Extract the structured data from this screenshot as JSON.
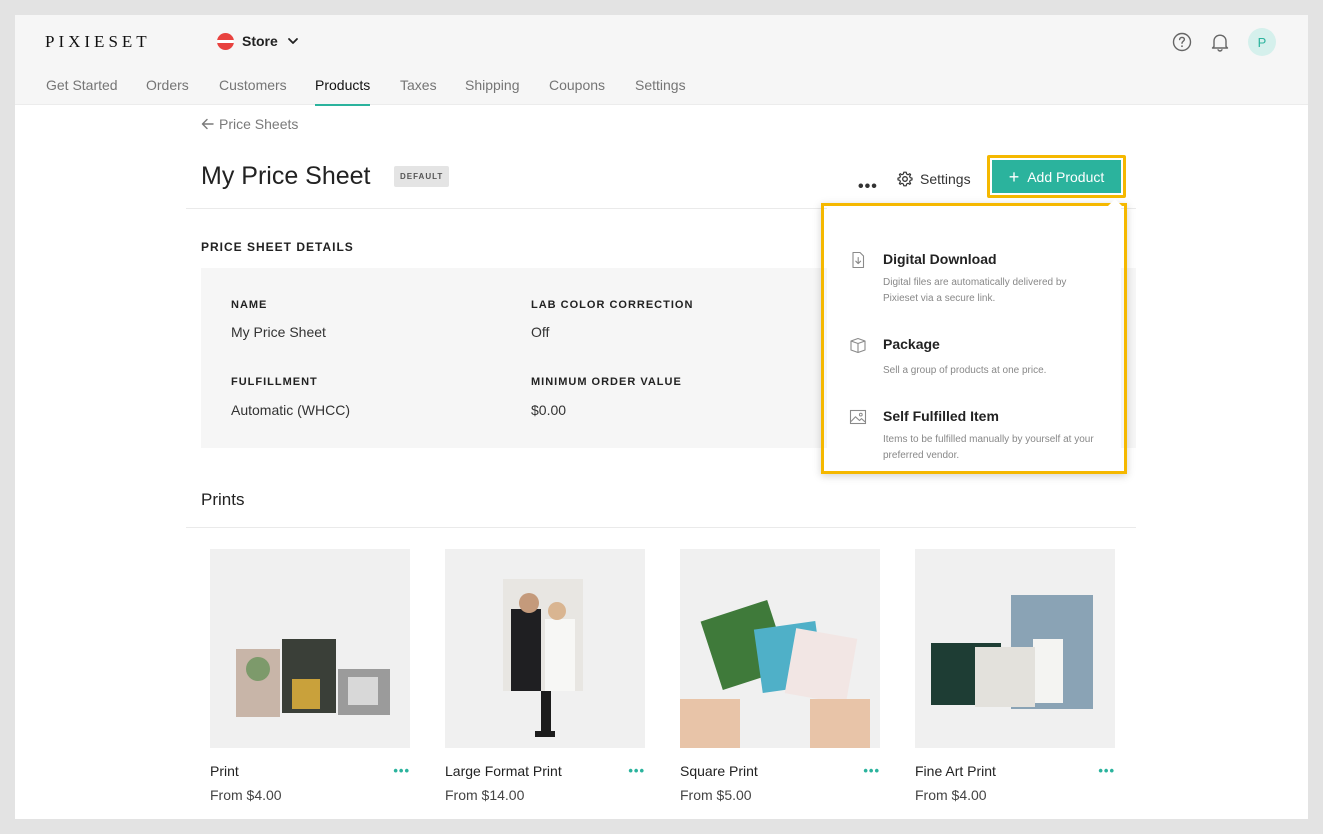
{
  "app": {
    "logo": "PIXIESET"
  },
  "store": {
    "label": "Store"
  },
  "top_icons": {
    "help": "help-icon",
    "notifications": "bell-icon"
  },
  "avatar": {
    "initial": "P"
  },
  "nav": {
    "items": [
      {
        "label": "Get Started"
      },
      {
        "label": "Orders"
      },
      {
        "label": "Customers"
      },
      {
        "label": "Products",
        "active": true
      },
      {
        "label": "Taxes"
      },
      {
        "label": "Shipping"
      },
      {
        "label": "Coupons"
      },
      {
        "label": "Settings"
      }
    ]
  },
  "breadcrumb": {
    "back_label": "Price Sheets"
  },
  "header": {
    "title": "My Price Sheet",
    "badge": "DEFAULT",
    "more": "•••",
    "settings_label": "Settings",
    "add_label": "Add Product",
    "add_plus": "+"
  },
  "details": {
    "heading": "PRICE SHEET DETAILS",
    "fields": [
      {
        "label": "NAME",
        "value": "My Price Sheet"
      },
      {
        "label": "LAB COLOR CORRECTION",
        "value": "Off"
      },
      {
        "label": "FULFILLMENT",
        "value": "Automatic (WHCC)"
      },
      {
        "label": "MINIMUM ORDER VALUE",
        "value": "$0.00"
      }
    ]
  },
  "prints": {
    "title": "Prints",
    "cards": [
      {
        "name": "Print",
        "price": "From $4.00",
        "more": "•••"
      },
      {
        "name": "Large Format Print",
        "price": "From $14.00",
        "more": "•••"
      },
      {
        "name": "Square Print",
        "price": "From $5.00",
        "more": "•••"
      },
      {
        "name": "Fine Art Print",
        "price": "From $4.00",
        "more": "•••"
      }
    ]
  },
  "dropdown": {
    "items": [
      {
        "title": "Digital Download",
        "desc": "Digital files are automatically delivered by Pixieset via a secure link.",
        "icon": "download-file-icon"
      },
      {
        "title": "Package",
        "desc": "Sell a group of products at one price.",
        "icon": "box-icon"
      },
      {
        "title": "Self Fulfilled Item",
        "desc": "Items to be fulfilled manually by yourself at your preferred vendor.",
        "icon": "image-icon"
      }
    ]
  },
  "colors": {
    "accent": "#2bb39d",
    "highlight": "#f5b800",
    "brand_red": "#e8423f"
  }
}
